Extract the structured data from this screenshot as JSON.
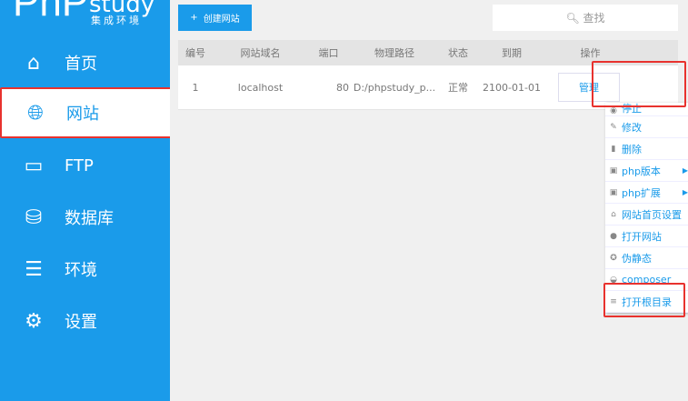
{
  "logo": {
    "main": "PhP",
    "sub": "study",
    "tagline": "集成环境"
  },
  "sidebar": {
    "items": [
      {
        "label": "首页",
        "icon": "home-icon"
      },
      {
        "label": "网站",
        "icon": "globe-icon"
      },
      {
        "label": "FTP",
        "icon": "server-icon"
      },
      {
        "label": "数据库",
        "icon": "database-icon"
      },
      {
        "label": "环境",
        "icon": "sliders-icon"
      },
      {
        "label": "设置",
        "icon": "gear-icon"
      }
    ]
  },
  "toolbar": {
    "create_label": "创建网站",
    "search_placeholder": "查找"
  },
  "table": {
    "headers": [
      "编号",
      "网站域名",
      "端口",
      "物理路径",
      "状态",
      "到期",
      "操作"
    ],
    "rows": [
      {
        "id": "1",
        "domain": "localhost",
        "port": "80",
        "path": "D:/phpstudy_p...",
        "status": "正常",
        "expiry": "2100-01-01",
        "action": "管理"
      }
    ]
  },
  "menu": {
    "items": [
      "停止",
      "修改",
      "删除",
      "php版本",
      "php扩展",
      "网站首页设置",
      "打开网站",
      "伪静态",
      "composer",
      "打开根目录"
    ]
  },
  "colors": {
    "accent": "#1a9bea",
    "highlight": "#e8322e"
  }
}
